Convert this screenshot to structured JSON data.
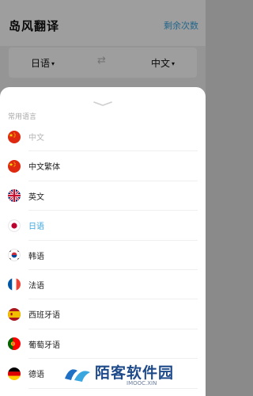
{
  "header": {
    "title": "岛风翻译",
    "remaining_link": "剩余次数"
  },
  "language_bar": {
    "from": "日语",
    "to": "中文",
    "caret": "▾",
    "swap_icon": "swap-arrows-icon",
    "swap_glyph": "⇄"
  },
  "sheet": {
    "section_title": "常用语言",
    "languages": [
      {
        "label": "中文",
        "flag": "china-flag-icon",
        "state": "disabled"
      },
      {
        "label": "中文繁体",
        "flag": "china-flag-icon",
        "state": "normal"
      },
      {
        "label": "英文",
        "flag": "uk-flag-icon",
        "state": "normal"
      },
      {
        "label": "日语",
        "flag": "japan-flag-icon",
        "state": "selected"
      },
      {
        "label": "韩语",
        "flag": "korea-flag-icon",
        "state": "normal"
      },
      {
        "label": "法语",
        "flag": "france-flag-icon",
        "state": "normal"
      },
      {
        "label": "西班牙语",
        "flag": "spain-flag-icon",
        "state": "normal"
      },
      {
        "label": "葡萄牙语",
        "flag": "portugal-flag-icon",
        "state": "normal"
      },
      {
        "label": "德语",
        "flag": "germany-flag-icon",
        "state": "normal"
      }
    ]
  },
  "watermark": {
    "text": "陌客软件园",
    "sub": "IMOOC.XIN"
  },
  "colors": {
    "accent": "#3aa6e0",
    "muted": "#b5b5b5"
  }
}
